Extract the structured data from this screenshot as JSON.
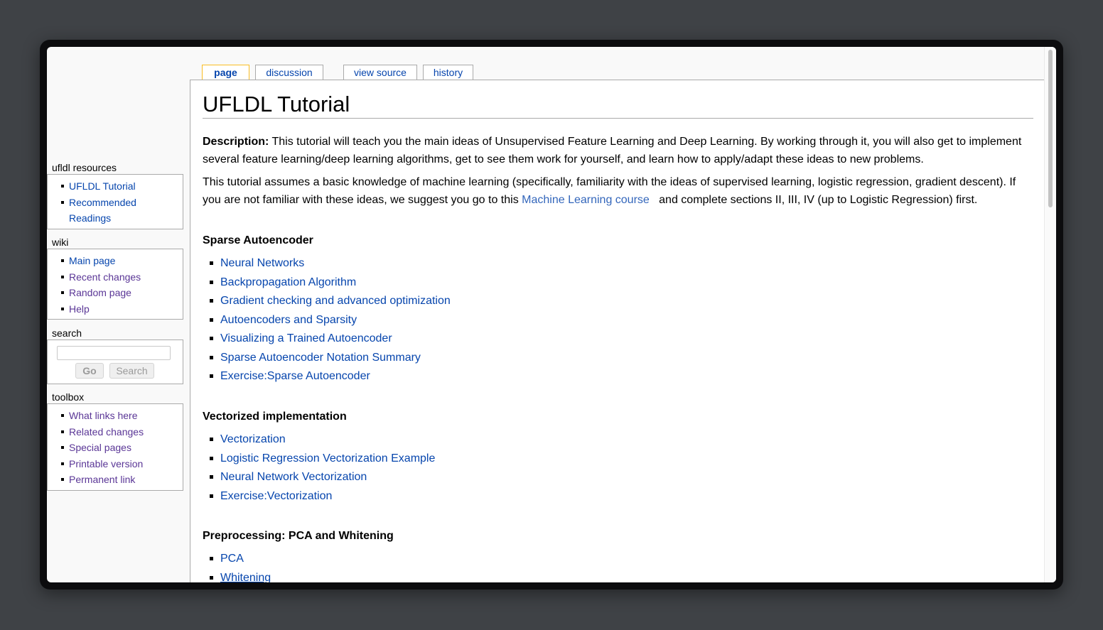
{
  "tabs": [
    {
      "label": "page"
    },
    {
      "label": "discussion"
    },
    {
      "label": "view source"
    },
    {
      "label": "history"
    }
  ],
  "page": {
    "title": "UFLDL Tutorial",
    "description_label": "Description:",
    "description_text": " This tutorial will teach you the main ideas of Unsupervised Feature Learning and Deep Learning. By working through it, you will also get to implement several feature learning/deep learning algorithms, get to see them work for yourself, and learn how to apply/adapt these ideas to new problems.",
    "intro_before": "This tutorial assumes a basic knowledge of machine learning (specifically, familiarity with the ideas of supervised learning, logistic regression, gradient descent). If you are not familiar with these ideas, we suggest you go to this ",
    "intro_link": "Machine Learning course",
    "intro_after": "   and complete sections II, III, IV (up to Logistic Regression) first."
  },
  "sections": [
    {
      "heading": "Sparse Autoencoder",
      "links": [
        "Neural Networks",
        "Backpropagation Algorithm",
        "Gradient checking and advanced optimization",
        "Autoencoders and Sparsity",
        "Visualizing a Trained Autoencoder",
        "Sparse Autoencoder Notation Summary",
        "Exercise:Sparse Autoencoder"
      ]
    },
    {
      "heading": "Vectorized implementation",
      "links": [
        "Vectorization",
        "Logistic Regression Vectorization Example",
        "Neural Network Vectorization",
        "Exercise:Vectorization"
      ]
    },
    {
      "heading": "Preprocessing: PCA and Whitening",
      "links": [
        "PCA",
        "Whitening"
      ]
    }
  ],
  "sidebar": {
    "resources": {
      "title": "ufldl resources",
      "items": [
        "UFLDL Tutorial",
        "Recommended",
        "Readings"
      ]
    },
    "wiki": {
      "title": "wiki",
      "items": [
        "Main page",
        "Recent changes",
        "Random page",
        "Help"
      ]
    },
    "search": {
      "title": "search",
      "go_label": "Go",
      "search_label": "Search",
      "value": ""
    },
    "toolbox": {
      "title": "toolbox",
      "items": [
        "What links here",
        "Related changes",
        "Special pages",
        "Printable version",
        "Permanent link"
      ]
    }
  },
  "colors": {
    "link": "#0645ad",
    "visited": "#5a3696",
    "external": "#3366bb",
    "selected_tab_border": "#fabd23"
  }
}
